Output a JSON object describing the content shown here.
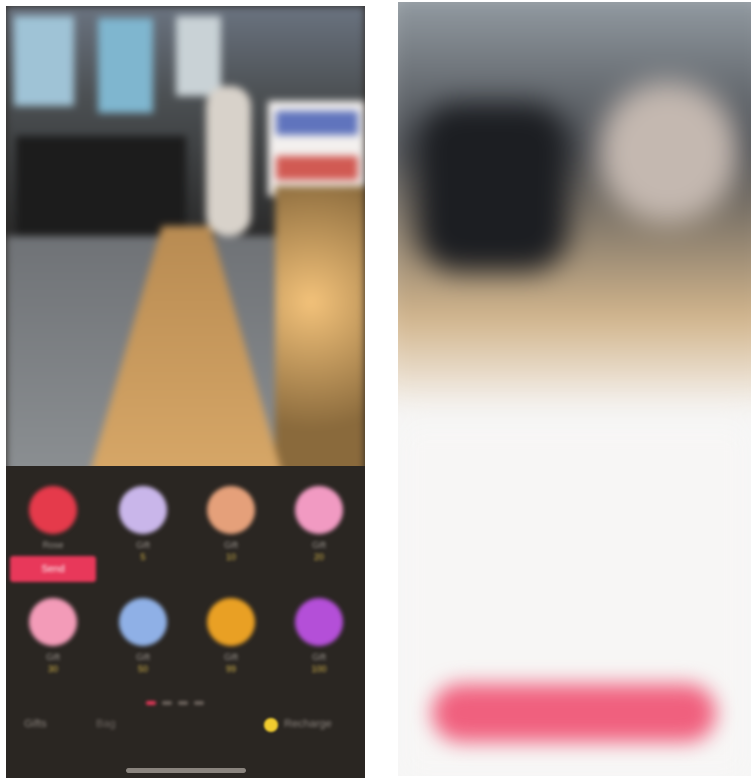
{
  "left_screen": {
    "gifts": [
      {
        "icon": "rose-icon",
        "name": "Rose",
        "price": "1",
        "color": "#e53a4b"
      },
      {
        "icon": "unicorn-icon",
        "name": "Gift",
        "price": "5",
        "color": "#c9b6ea"
      },
      {
        "icon": "gift-icon",
        "name": "Gift",
        "price": "10",
        "color": "#e5a07a"
      },
      {
        "icon": "bouquet-icon",
        "name": "Gift",
        "price": "20",
        "color": "#f19ac2"
      },
      {
        "icon": "flower-icon",
        "name": "Gift",
        "price": "30",
        "color": "#f39bb8"
      },
      {
        "icon": "bird-icon",
        "name": "Gift",
        "price": "50",
        "color": "#8fb0e6"
      },
      {
        "icon": "boat-icon",
        "name": "Gift",
        "price": "99",
        "color": "#e9a024"
      },
      {
        "icon": "box-icon",
        "name": "Gift",
        "price": "100",
        "color": "#b44fd8"
      }
    ],
    "send_label": "Send",
    "bottom": {
      "left": "Gifts",
      "middle": "Bag",
      "right": "Recharge"
    }
  },
  "colors": {
    "accent": "#e8385a",
    "coin": "#f1cc2f"
  }
}
